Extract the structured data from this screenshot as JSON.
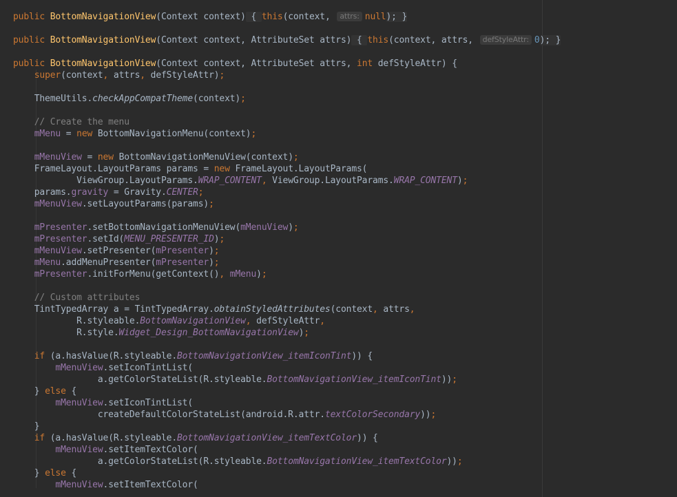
{
  "editor": {
    "lines": [
      [
        [
          "kw",
          "public "
        ],
        [
          "fn",
          "BottomNavigationView"
        ],
        [
          "",
          "(Context context)"
        ],
        [
          "fold",
          " { "
        ],
        [
          "kw",
          "this"
        ],
        [
          "",
          "(context, "
        ],
        [
          "hint",
          "attrs:"
        ],
        [
          "kw",
          "null"
        ],
        [
          "fold",
          "); }"
        ]
      ],
      [],
      [
        [
          "kw",
          "public "
        ],
        [
          "fn",
          "BottomNavigationView"
        ],
        [
          "",
          "(Context context, AttributeSet attrs)"
        ],
        [
          "fold",
          " { "
        ],
        [
          "kw",
          "this"
        ],
        [
          "",
          "(context, attrs, "
        ],
        [
          "hint",
          "defStyleAttr:"
        ],
        [
          "num",
          "0"
        ],
        [
          "fold",
          "); }"
        ]
      ],
      [],
      [
        [
          "kw",
          "public "
        ],
        [
          "fn",
          "BottomNavigationView"
        ],
        [
          "",
          "(Context context, AttributeSet attrs, "
        ],
        [
          "kw",
          "int "
        ],
        [
          "",
          "defStyleAttr) {"
        ]
      ],
      [
        [
          "",
          "    "
        ],
        [
          "kw",
          "super"
        ],
        [
          "",
          "(context"
        ],
        [
          "kw",
          ", "
        ],
        [
          "",
          "attrs"
        ],
        [
          "kw",
          ", "
        ],
        [
          "",
          "defStyleAttr)"
        ],
        [
          "kw",
          ";"
        ]
      ],
      [],
      [
        [
          "",
          "    ThemeUtils."
        ],
        [
          "st",
          "checkAppCompatTheme"
        ],
        [
          "",
          "(context)"
        ],
        [
          "kw",
          ";"
        ]
      ],
      [],
      [
        [
          "cm",
          "    // Create the menu"
        ]
      ],
      [
        [
          "",
          "    "
        ],
        [
          "fld",
          "mMenu"
        ],
        [
          "",
          " = "
        ],
        [
          "kw",
          "new "
        ],
        [
          "",
          "BottomNavigationMenu(context)"
        ],
        [
          "kw",
          ";"
        ]
      ],
      [],
      [
        [
          "",
          "    "
        ],
        [
          "fld",
          "mMenuView"
        ],
        [
          "",
          " = "
        ],
        [
          "kw",
          "new "
        ],
        [
          "",
          "BottomNavigationMenuView(context)"
        ],
        [
          "kw",
          ";"
        ]
      ],
      [
        [
          "",
          "    FrameLayout.LayoutParams params = "
        ],
        [
          "kw",
          "new "
        ],
        [
          "",
          "FrameLayout.LayoutParams("
        ]
      ],
      [
        [
          "",
          "            ViewGroup.LayoutParams."
        ],
        [
          "sf",
          "WRAP_CONTENT"
        ],
        [
          "kw",
          ", "
        ],
        [
          "",
          "ViewGroup.LayoutParams."
        ],
        [
          "sf",
          "WRAP_CONTENT"
        ],
        [
          "",
          ")"
        ],
        [
          "kw",
          ";"
        ]
      ],
      [
        [
          "",
          "    params."
        ],
        [
          "fld",
          "gravity"
        ],
        [
          "",
          " = Gravity."
        ],
        [
          "sf",
          "CENTER"
        ],
        [
          "kw",
          ";"
        ]
      ],
      [
        [
          "",
          "    "
        ],
        [
          "fld",
          "mMenuView"
        ],
        [
          "",
          ".setLayoutParams(params)"
        ],
        [
          "kw",
          ";"
        ]
      ],
      [],
      [
        [
          "",
          "    "
        ],
        [
          "fld",
          "mPresenter"
        ],
        [
          "",
          ".setBottomNavigationMenuView("
        ],
        [
          "fld",
          "mMenuView"
        ],
        [
          "",
          ")"
        ],
        [
          "kw",
          ";"
        ]
      ],
      [
        [
          "",
          "    "
        ],
        [
          "fld",
          "mPresenter"
        ],
        [
          "",
          ".setId("
        ],
        [
          "sf",
          "MENU_PRESENTER_ID"
        ],
        [
          "",
          ")"
        ],
        [
          "kw",
          ";"
        ]
      ],
      [
        [
          "",
          "    "
        ],
        [
          "fld",
          "mMenuView"
        ],
        [
          "",
          ".setPresenter("
        ],
        [
          "fld",
          "mPresenter"
        ],
        [
          "",
          ")"
        ],
        [
          "kw",
          ";"
        ]
      ],
      [
        [
          "",
          "    "
        ],
        [
          "fld",
          "mMenu"
        ],
        [
          "",
          ".addMenuPresenter("
        ],
        [
          "fld",
          "mPresenter"
        ],
        [
          "",
          ")"
        ],
        [
          "kw",
          ";"
        ]
      ],
      [
        [
          "",
          "    "
        ],
        [
          "fld",
          "mPresenter"
        ],
        [
          "",
          ".initForMenu(getContext()"
        ],
        [
          "kw",
          ", "
        ],
        [
          "fld",
          "mMenu"
        ],
        [
          "",
          ")"
        ],
        [
          "kw",
          ";"
        ]
      ],
      [],
      [
        [
          "cm",
          "    // Custom attributes"
        ]
      ],
      [
        [
          "",
          "    TintTypedArray a = TintTypedArray."
        ],
        [
          "st",
          "obtainStyledAttributes"
        ],
        [
          "",
          "(context"
        ],
        [
          "kw",
          ", "
        ],
        [
          "",
          "attrs"
        ],
        [
          "kw",
          ","
        ]
      ],
      [
        [
          "",
          "            R.styleable."
        ],
        [
          "sf",
          "BottomNavigationView"
        ],
        [
          "kw",
          ", "
        ],
        [
          "",
          "defStyleAttr"
        ],
        [
          "kw",
          ","
        ]
      ],
      [
        [
          "",
          "            R.style."
        ],
        [
          "sf",
          "Widget_Design_BottomNavigationView"
        ],
        [
          "",
          ")"
        ],
        [
          "kw",
          ";"
        ]
      ],
      [],
      [
        [
          "",
          "    "
        ],
        [
          "kw",
          "if "
        ],
        [
          "",
          "(a.hasValue(R.styleable."
        ],
        [
          "sf",
          "BottomNavigationView_itemIconTint"
        ],
        [
          "",
          ")) {"
        ]
      ],
      [
        [
          "",
          "        "
        ],
        [
          "fld",
          "mMenuView"
        ],
        [
          "",
          ".setIconTintList("
        ]
      ],
      [
        [
          "",
          "                a.getColorStateList(R.styleable."
        ],
        [
          "sf",
          "BottomNavigationView_itemIconTint"
        ],
        [
          "",
          "))"
        ],
        [
          "kw",
          ";"
        ]
      ],
      [
        [
          "",
          "    } "
        ],
        [
          "kw",
          "else "
        ],
        [
          "",
          "{"
        ]
      ],
      [
        [
          "",
          "        "
        ],
        [
          "fld",
          "mMenuView"
        ],
        [
          "",
          ".setIconTintList("
        ]
      ],
      [
        [
          "",
          "                createDefaultColorStateList(android.R.attr."
        ],
        [
          "sf",
          "textColorSecondary"
        ],
        [
          "",
          "))"
        ],
        [
          "kw",
          ";"
        ]
      ],
      [
        [
          "",
          "    }"
        ]
      ],
      [
        [
          "",
          "    "
        ],
        [
          "kw",
          "if "
        ],
        [
          "",
          "(a.hasValue(R.styleable."
        ],
        [
          "sf",
          "BottomNavigationView_itemTextColor"
        ],
        [
          "",
          ")) {"
        ]
      ],
      [
        [
          "",
          "        "
        ],
        [
          "fld",
          "mMenuView"
        ],
        [
          "",
          ".setItemTextColor("
        ]
      ],
      [
        [
          "",
          "                a.getColorStateList(R.styleable."
        ],
        [
          "sf",
          "BottomNavigationView_itemTextColor"
        ],
        [
          "",
          "))"
        ],
        [
          "kw",
          ";"
        ]
      ],
      [
        [
          "",
          "    } "
        ],
        [
          "kw",
          "else "
        ],
        [
          "",
          "{"
        ]
      ],
      [
        [
          "",
          "        "
        ],
        [
          "fld",
          "mMenuView"
        ],
        [
          "",
          ".setItemTextColor("
        ]
      ]
    ]
  },
  "colors": {
    "background": "#2b2b2b",
    "keyword": "#cc7832",
    "method": "#ffc66d",
    "field": "#9876aa",
    "number": "#6897bb",
    "comment": "#808080",
    "text": "#a9b7c6"
  }
}
